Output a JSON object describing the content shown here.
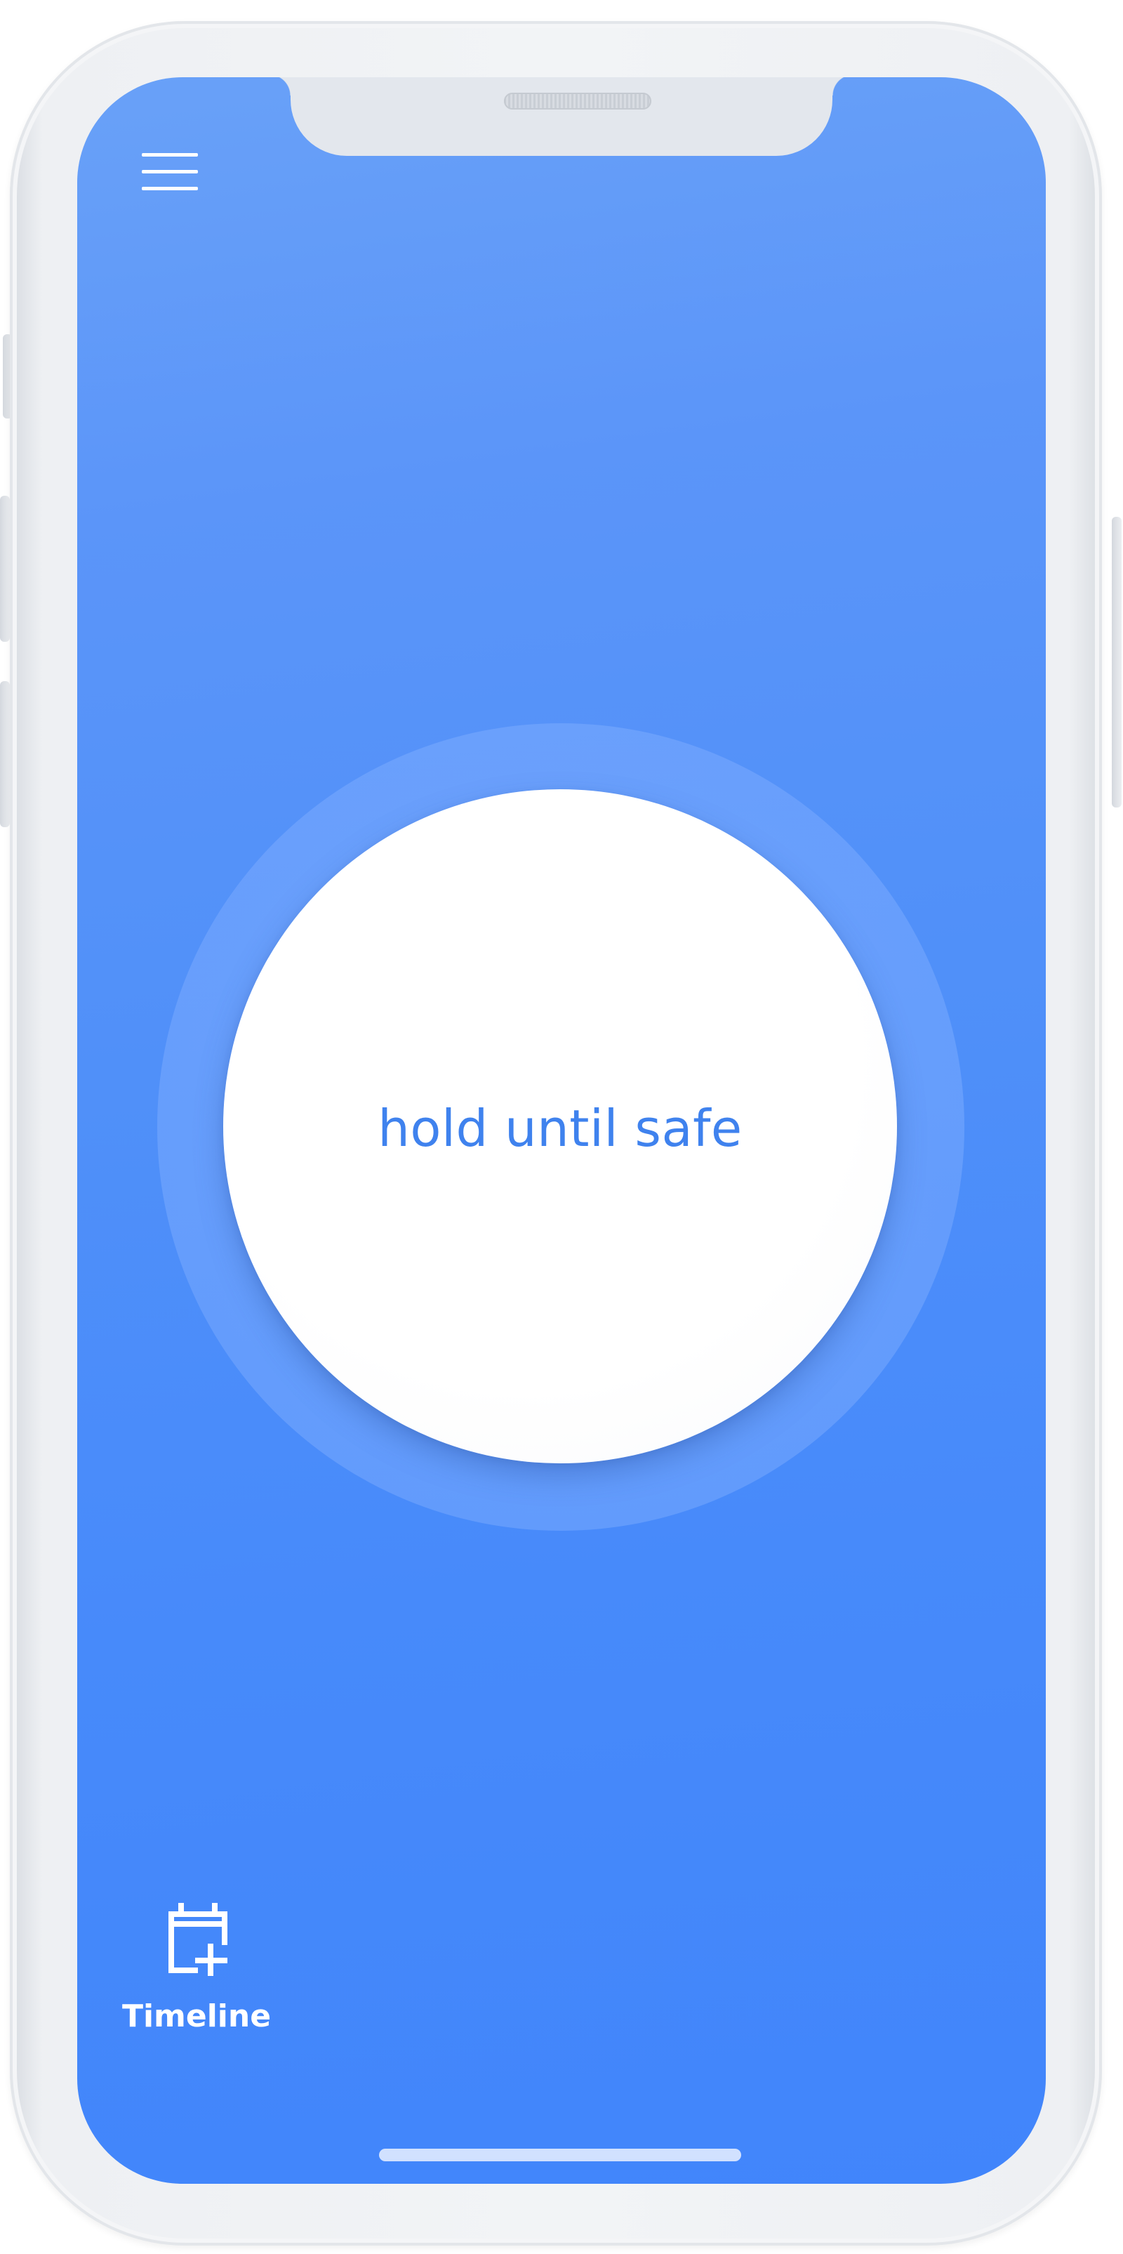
{
  "app": {
    "background_colors": [
      "#69a1f8",
      "#4185fb"
    ],
    "accent_color": "#3f82ee"
  },
  "header": {
    "menu_icon": "hamburger-menu-icon"
  },
  "main": {
    "hold_button_label": "hold until safe"
  },
  "bottom_nav": {
    "timeline_icon": "calendar-plus-icon",
    "timeline_label": "Timeline"
  }
}
